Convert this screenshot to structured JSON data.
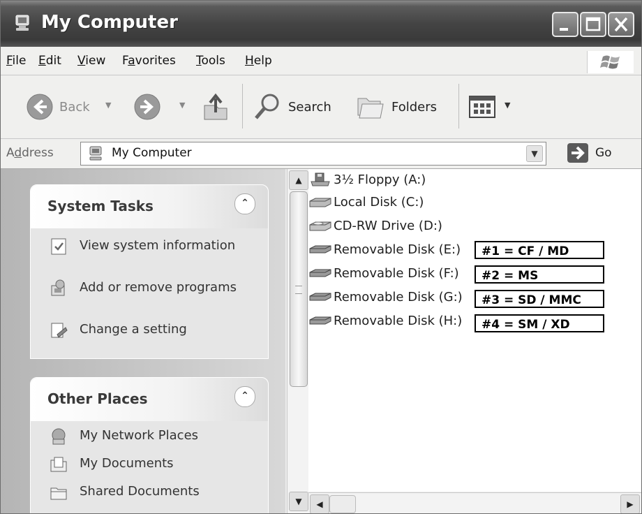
{
  "window": {
    "title": "My Computer",
    "icon": "my-computer-icon",
    "controls": [
      "minimize-icon",
      "maximize-icon",
      "close-icon"
    ]
  },
  "menubar": {
    "items": [
      {
        "label": "File",
        "accel": "F",
        "rest": "ile"
      },
      {
        "label": "Edit",
        "accel": "E",
        "rest": "dit"
      },
      {
        "label": "View",
        "accel": "V",
        "rest": "iew"
      },
      {
        "label": "Favorites",
        "pre": "F",
        "accel": "a",
        "rest": "vorites"
      },
      {
        "label": "Tools",
        "accel": "T",
        "rest": "ools"
      },
      {
        "label": "Help",
        "accel": "H",
        "rest": "elp"
      }
    ]
  },
  "toolbar": {
    "back_label": "Back",
    "search_label": "Search",
    "folders_label": "Folders"
  },
  "address": {
    "label_pre": "A",
    "label_accel": "d",
    "label_rest": "dress",
    "value": "My Computer",
    "go_label": "Go"
  },
  "system_tasks": {
    "title": "System Tasks",
    "items": [
      {
        "label": "View system information",
        "icon": "system-info-icon"
      },
      {
        "label": "Add or remove programs",
        "icon": "add-remove-programs-icon"
      },
      {
        "label": "Change a setting",
        "icon": "control-panel-icon"
      }
    ]
  },
  "other_places": {
    "title": "Other Places",
    "items": [
      {
        "label": "My Network Places",
        "icon": "network-places-icon"
      },
      {
        "label": "My Documents",
        "icon": "my-documents-icon"
      },
      {
        "label": "Shared Documents",
        "icon": "shared-documents-icon"
      }
    ]
  },
  "drives": [
    {
      "label": "3½ Floppy (A:)",
      "icon": "floppy-drive-icon"
    },
    {
      "label": "Local Disk (C:)",
      "icon": "hard-disk-icon"
    },
    {
      "label": "CD-RW Drive (D:)",
      "icon": "cd-drive-icon"
    },
    {
      "label": "Removable Disk (E:)",
      "icon": "removable-disk-icon",
      "annotation": "#1 = CF / MD"
    },
    {
      "label": "Removable Disk (F:)",
      "icon": "removable-disk-icon",
      "annotation": "#2 = MS"
    },
    {
      "label": "Removable Disk (G:)",
      "icon": "removable-disk-icon",
      "annotation": "#3 = SD / MMC"
    },
    {
      "label": "Removable Disk (H:)",
      "icon": "removable-disk-icon",
      "annotation": "#4 = SM / XD"
    }
  ]
}
